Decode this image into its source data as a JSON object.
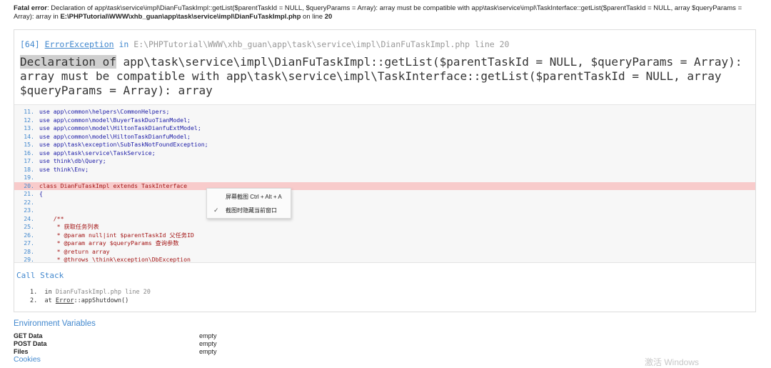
{
  "fatal": {
    "label": "Fatal error",
    "message": ": Declaration of app\\task\\service\\impl\\DianFuTaskImpl::getList($parentTaskId = NULL, $queryParams = Array): array must be compatible with app\\task\\service\\impl\\TaskInterface::getList($parentTaskId = NULL, array $queryParams = Array): array in ",
    "file": "E:\\PHPTutorial\\WWW\\xhb_guan\\app\\task\\service\\impl\\DianFuTaskImpl.php",
    "on_line_text": " on line ",
    "line": "20"
  },
  "exception": {
    "code": "[64]",
    "class": "ErrorException",
    "in_text": " in ",
    "path": "E:\\PHPTutorial\\WWW\\xhb_guan\\app\\task\\service\\impl\\DianFuTaskImpl.php line 20",
    "msg_highlight": "Declaration of",
    "msg_rest": " app\\task\\service\\impl\\DianFuTaskImpl::getList($parentTaskId = NULL, $queryParams = Array): array must be compatible with app\\task\\service\\impl\\TaskInterface::getList($parentTaskId = NULL, array $queryParams = Array): array"
  },
  "source": {
    "lines": [
      {
        "num": "11.",
        "text": "use app\\common\\helpers\\CommonHelpers;"
      },
      {
        "num": "12.",
        "text": "use app\\common\\model\\BuyerTaskDuoTianModel;"
      },
      {
        "num": "13.",
        "text": "use app\\common\\model\\HiltonTaskDianfuExtModel;"
      },
      {
        "num": "14.",
        "text": "use app\\common\\model\\HiltonTaskDianfuModel;"
      },
      {
        "num": "15.",
        "text": "use app\\task\\exception\\SubTaskNotFoundException;"
      },
      {
        "num": "16.",
        "text": "use app\\task\\service\\TaskService;"
      },
      {
        "num": "17.",
        "text": "use think\\db\\Query;"
      },
      {
        "num": "18.",
        "text": "use think\\Env;"
      },
      {
        "num": "19.",
        "text": ""
      },
      {
        "num": "20.",
        "text": "class DianFuTaskImpl extends TaskInterface"
      },
      {
        "num": "21.",
        "text": "{"
      },
      {
        "num": "22.",
        "text": ""
      },
      {
        "num": "23.",
        "text": ""
      },
      {
        "num": "24.",
        "text": "    /**"
      },
      {
        "num": "25.",
        "text": "     * 获取任务列表"
      },
      {
        "num": "26.",
        "text": "     * @param null|int $parentTaskId 父任务ID"
      },
      {
        "num": "27.",
        "text": "     * @param array $queryParams 查询参数"
      },
      {
        "num": "28.",
        "text": "     * @return array"
      },
      {
        "num": "29.",
        "text": "     * @throws \\think\\exception\\DbException"
      }
    ]
  },
  "callstack": {
    "title": "Call Stack",
    "item1_num": "1.",
    "item1_in": "in ",
    "item1_file": "DianFuTaskImpl.php line 20",
    "item2_num": "2.",
    "item2_at": "at ",
    "item2_class": "Error",
    "item2_method": "::appShutdown()"
  },
  "env": {
    "title": "Environment Variables",
    "rows": [
      {
        "key": "GET Data",
        "value": "empty"
      },
      {
        "key": "POST Data",
        "value": "empty"
      },
      {
        "key": "Files",
        "value": "empty"
      }
    ],
    "cookies": "Cookies"
  },
  "context_menu": {
    "item1": "屏幕截图 Ctrl + Alt + A",
    "item2": "截图时隐藏当前窗口",
    "check_icon": "✓"
  },
  "watermark": "激活 Windows"
}
